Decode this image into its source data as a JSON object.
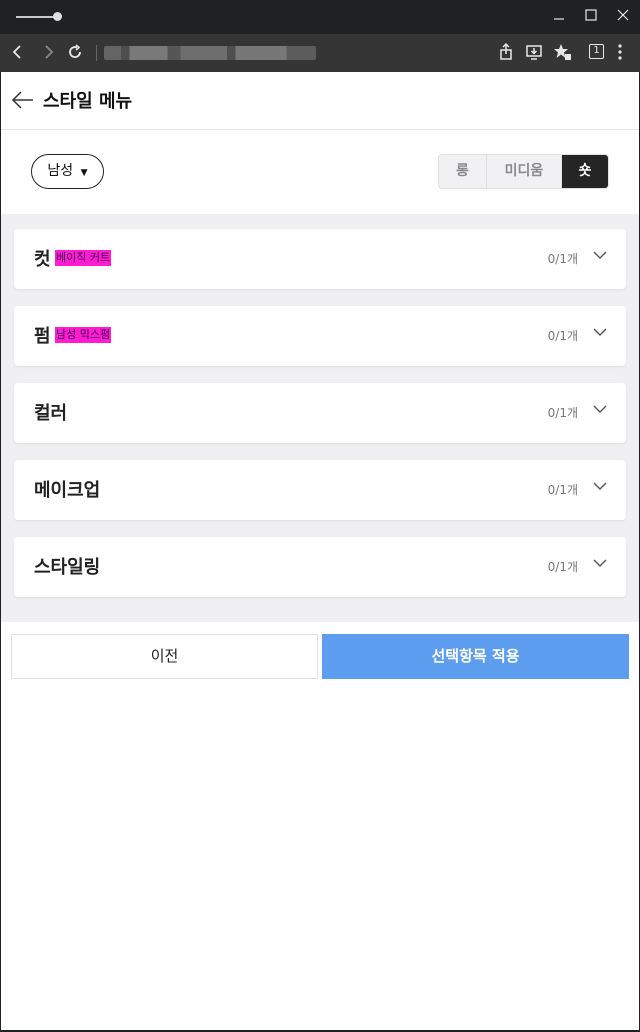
{
  "browser": {
    "title_bar_icons": [
      "slider-icon"
    ],
    "window_controls": [
      "minimize-icon",
      "maximize-icon",
      "close-icon"
    ],
    "toolbar_icons": [
      "back-icon",
      "forward-icon",
      "reload-icon",
      "share-icon",
      "install-icon",
      "favorites-icon",
      "tab-count-icon",
      "menu-icon"
    ],
    "tab_count": "1"
  },
  "page": {
    "title": "스타일 메뉴",
    "gender_label": "남성",
    "length_tabs": [
      {
        "label": "롱",
        "active": false
      },
      {
        "label": "미디움",
        "active": false
      },
      {
        "label": "숏",
        "active": true
      }
    ],
    "categories": [
      {
        "title": "컷",
        "selected": "베이직 커트",
        "count": "0/1개"
      },
      {
        "title": "펌",
        "selected": "남성 믹스펌",
        "count": "0/1개"
      },
      {
        "title": "컬러",
        "selected": "",
        "count": "0/1개"
      },
      {
        "title": "메이크업",
        "selected": "",
        "count": "0/1개"
      },
      {
        "title": "스타일링",
        "selected": "",
        "count": "0/1개"
      }
    ],
    "prev_button": "이전",
    "apply_button": "선택항목 적용"
  },
  "colors": {
    "accent": "#5d9df0",
    "highlight": "#ff1bd2",
    "active_tab": "#252525",
    "list_bg": "#f0f0f3"
  }
}
